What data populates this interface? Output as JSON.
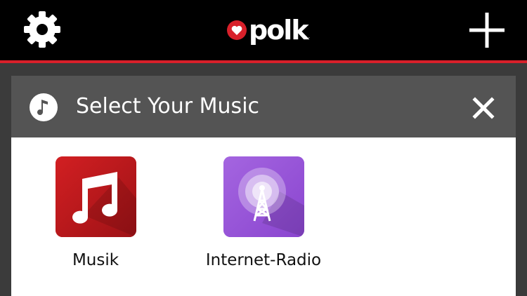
{
  "header": {
    "logo_text": "polk",
    "logo_tm": ".",
    "settings_icon": "gear-icon",
    "add_icon": "plus-icon"
  },
  "panel": {
    "title": "Select Your Music",
    "title_icon": "music-note-icon",
    "close_icon": "close-icon",
    "sources": [
      {
        "label": "Musik",
        "icon": "music-notes-icon",
        "color": "#c21b1e"
      },
      {
        "label": "Internet-Radio",
        "icon": "radio-tower-icon",
        "color": "#9a58d9"
      }
    ]
  },
  "colors": {
    "topbar": "#000000",
    "accent_red": "#d8202a",
    "panel_header": "#545454",
    "background": "#3b3b3b"
  }
}
